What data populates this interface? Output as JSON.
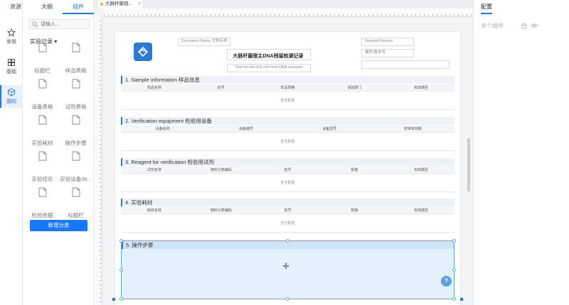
{
  "tabs": [
    "资源",
    "大纲",
    "组件"
  ],
  "rail": [
    {
      "label": "常用",
      "icon": "star-icon"
    },
    {
      "label": "基础",
      "icon": "grid-icon"
    },
    {
      "label": "我的",
      "icon": "cube-icon"
    }
  ],
  "search": {
    "placeholder": "请输入..."
  },
  "category": "实验记录 ▾",
  "components": [
    "标题栏",
    "样品表格",
    "设备表格",
    "试剂表格",
    "实验耗材",
    "操作步骤",
    "实验结论",
    "实验设备06...",
    "检验依据",
    "标题栏"
  ],
  "add_category": "新增分类",
  "doc_tab": {
    "label": "大肠杆菌宿...",
    "close": "×"
  },
  "document": {
    "name_placeholder": "Document Name 文档名称",
    "title": "大肠杆菌宿主DNA残留检测记录",
    "subtitle": "Test record of E.coli host DNA residues",
    "version_placeholder": "Number/Version",
    "number_label": "编号/版本号"
  },
  "sections": [
    {
      "title": "1. Sample information 样品信息",
      "columns": [
        "样品名称",
        "批号",
        "样品规格",
        "请验部门",
        "有效期至"
      ],
      "empty": "暂无数据"
    },
    {
      "title": "2. Verification equipment 检验用设备",
      "columns": [
        "设备名称",
        "设备编号",
        "设备型号",
        "校准有效期"
      ],
      "empty": "暂无数据"
    },
    {
      "title": "3. Reagent for verification 检验用试剂",
      "columns": [
        "试剂名称",
        "物料分类编码",
        "批号",
        "规格",
        "有效期至"
      ],
      "empty": "暂无数据"
    },
    {
      "title": "4. 实验耗材",
      "columns": [
        "耗材名称",
        "物料分类编码",
        "批号",
        "规格",
        "有效期至"
      ],
      "empty": "暂无数据"
    }
  ],
  "selected_section": {
    "title": "5. 操作步骤"
  },
  "help": "?",
  "config": {
    "title": "配置",
    "multi": "多个组件"
  }
}
